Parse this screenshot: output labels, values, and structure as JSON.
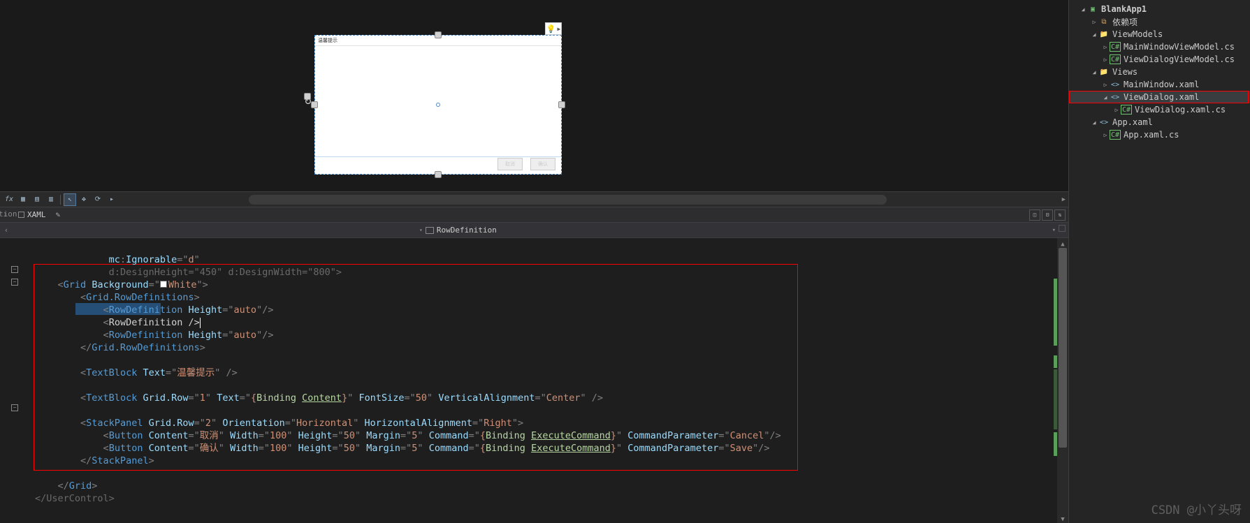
{
  "solution": {
    "project": "BlankApp1",
    "items": [
      {
        "exp": "▷",
        "ic": "dep",
        "label": "依赖项",
        "pad": 1
      },
      {
        "exp": "◢",
        "ic": "folder",
        "label": "ViewModels",
        "pad": 1
      },
      {
        "exp": "▷",
        "ic": "cs",
        "label": "MainWindowViewModel.cs",
        "pad": 2
      },
      {
        "exp": "▷",
        "ic": "cs",
        "label": "ViewDialogViewModel.cs",
        "pad": 2
      },
      {
        "exp": "◢",
        "ic": "folder",
        "label": "Views",
        "pad": 1
      },
      {
        "exp": "▷",
        "ic": "xaml",
        "label": "MainWindow.xaml",
        "pad": 2
      },
      {
        "exp": "◢",
        "ic": "xaml",
        "label": "ViewDialog.xaml",
        "pad": 2,
        "sel": true
      },
      {
        "exp": "▷",
        "ic": "cs",
        "label": "ViewDialog.xaml.cs",
        "pad": 3
      },
      {
        "exp": "◢",
        "ic": "xaml",
        "label": "App.xaml",
        "pad": 1
      },
      {
        "exp": "▷",
        "ic": "cs",
        "label": "App.xaml.cs",
        "pad": 2
      }
    ]
  },
  "tab": {
    "label": "XAML"
  },
  "breadcrumb": {
    "right": "RowDefinition"
  },
  "designer": {
    "topText": "温馨提示",
    "cancel": "取消",
    "ok": "确认"
  },
  "code": {
    "l0a": "mc",
    "l0b": ":",
    "l0c": "Ignorable",
    "l0d": "=\"",
    "l0e": "d",
    "l0f": "\"",
    "l1a": "d",
    "l1b": ":",
    "l1c": "DesignHeight",
    "l1d": "=\"",
    "l1e": "450",
    "l1f": "\"",
    "l1g": "d",
    "l1h": ":",
    "l1i": "DesignWidth",
    "l1j": "=\"",
    "l1k": "800",
    "l1l": "\">",
    "l2": "Grid",
    "l2b": "Background",
    "l2c": "=\"",
    "l2d": "White",
    "l2e": "\">",
    "l3": "Grid.RowDefinitions",
    "l4": "RowDefinition",
    "l4b": "Height",
    "l4c": "=\"",
    "l4d": "auto",
    "l4e": "\"/>",
    "l5": "RowDefinition",
    "l5b": "/>",
    "l6": "RowDefinition",
    "l6b": "Height",
    "l6c": "=\"",
    "l6d": "auto",
    "l6e": "\"/>",
    "l7": "Grid.RowDefinitions",
    "l9": "TextBlock",
    "l9b": "Text",
    "l9c": "=\"",
    "l9d": "温馨提示",
    "l9e": "\" />",
    "l11": "TextBlock",
    "l11b": "Grid.Row",
    "l11c": "=\"",
    "l11d": "1",
    "l11e": "\"",
    "l11f": "Text",
    "l11g": "=\"",
    "l11h": "{",
    "l11i": "Binding",
    "l11j": "Content",
    "l11k": "}",
    "l11l": "\"",
    "l11m": "FontSize",
    "l11n": "=\"",
    "l11o": "50",
    "l11p": "\"",
    "l11q": "VerticalAlignment",
    "l11r": "=\"",
    "l11s": "Center",
    "l11t": "\" />",
    "l13": "StackPanel",
    "l13b": "Grid.Row",
    "l13c": "=\"",
    "l13d": "2",
    "l13e": "\"",
    "l13f": "Orientation",
    "l13g": "=\"",
    "l13h": "Horizontal",
    "l13i": "\"",
    "l13j": "HorizontalAlignment",
    "l13k": "=\"",
    "l13l": "Right",
    "l13m": "\">",
    "l14": "Button",
    "l14b": "Content",
    "l14c": "=\"",
    "l14d": "取消",
    "l14e": "\"",
    "l14f": "Width",
    "l14g": "=\"",
    "l14h": "100",
    "l14i": "\"",
    "l14j": "Height",
    "l14k": "=\"",
    "l14l": "50",
    "l14m": "\"",
    "l14n": "Margin",
    "l14o": "=\"",
    "l14p": "5",
    "l14q": "\"",
    "l14r": "Command",
    "l14s": "=\"",
    "l14t": "{",
    "l14u": "Binding",
    "l14v": "ExecuteCommand",
    "l14w": "}",
    "l14x": "\"",
    "l14y": "CommandParameter",
    "l14z": "=\"",
    "l14A": "Cancel",
    "l14B": "\"/>",
    "l15": "Button",
    "l15b": "Content",
    "l15c": "=\"",
    "l15d": "确认",
    "l15e": "\"",
    "l15f": "Width",
    "l15g": "=\"",
    "l15h": "100",
    "l15i": "\"",
    "l15j": "Height",
    "l15k": "=\"",
    "l15l": "50",
    "l15m": "\"",
    "l15n": "Margin",
    "l15o": "=\"",
    "l15p": "5",
    "l15q": "\"",
    "l15r": "Command",
    "l15s": "=\"",
    "l15t": "{",
    "l15u": "Binding",
    "l15v": "ExecuteCommand",
    "l15w": "}",
    "l15x": "\"",
    "l15y": "CommandParameter",
    "l15z": "=\"",
    "l15A": "Save",
    "l15B": "\"/>",
    "l16": "StackPanel",
    "l18": "Grid",
    "l19": "UserControl"
  },
  "watermark": "CSDN @小丫头呀",
  "leftlabel": "tion"
}
